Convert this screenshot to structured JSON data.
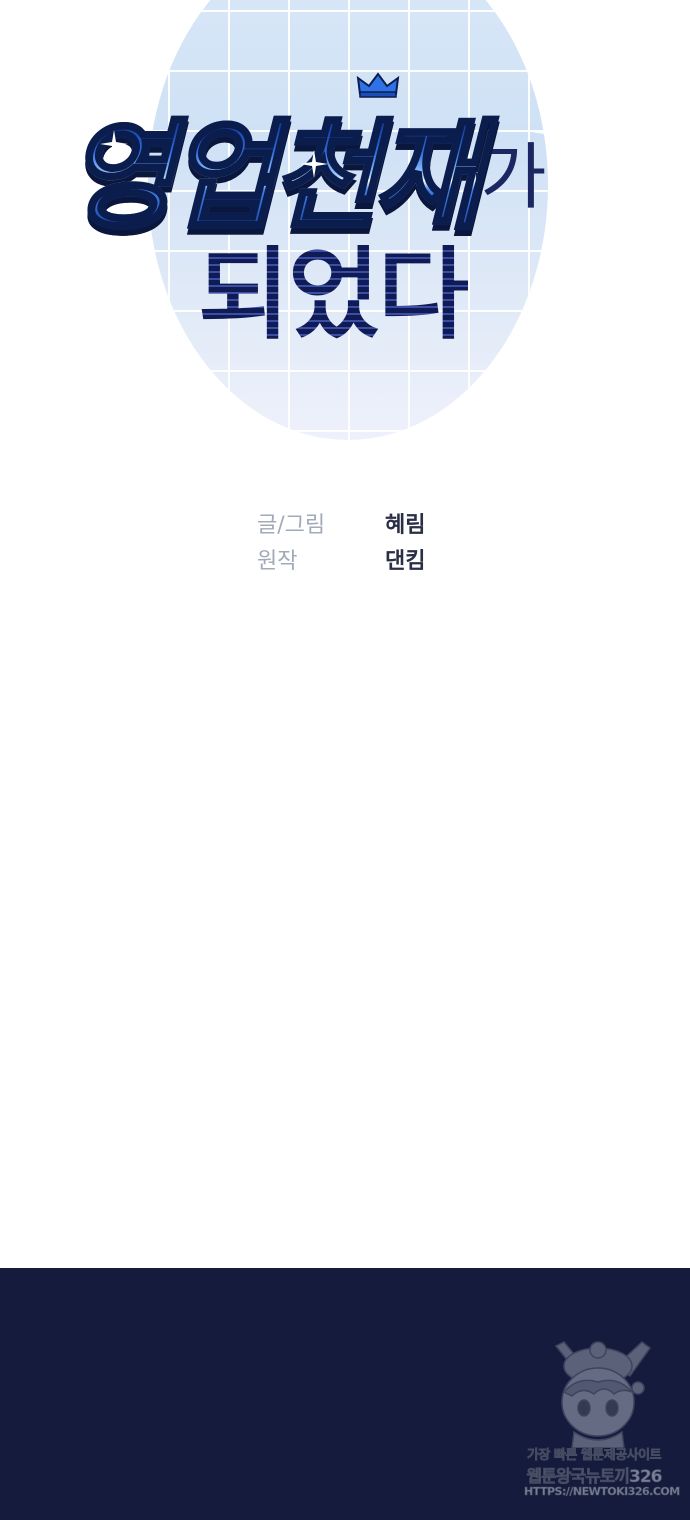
{
  "title": {
    "line1_main": "영업천재",
    "line1_suffix": "가",
    "line2": "되었다",
    "crown_icon": "crown-icon",
    "colors": {
      "primary_blue": "#1a4fb8",
      "dark_navy": "#1b2762",
      "grid_circle": "#d4e4f6"
    }
  },
  "credits": [
    {
      "role": "글/그림",
      "name": "혜림"
    },
    {
      "role": "원작",
      "name": "댄킴"
    }
  ],
  "bottom_panel": {
    "color": "#151b3d"
  },
  "watermark": {
    "line1": "가장 빠른 웹툰제공사이트",
    "line2": "웹툰왕국뉴토끼326",
    "line3": "HTTPS://NEWTOKI326.COM",
    "mascot_icon": "rabbit-mascot-icon"
  }
}
